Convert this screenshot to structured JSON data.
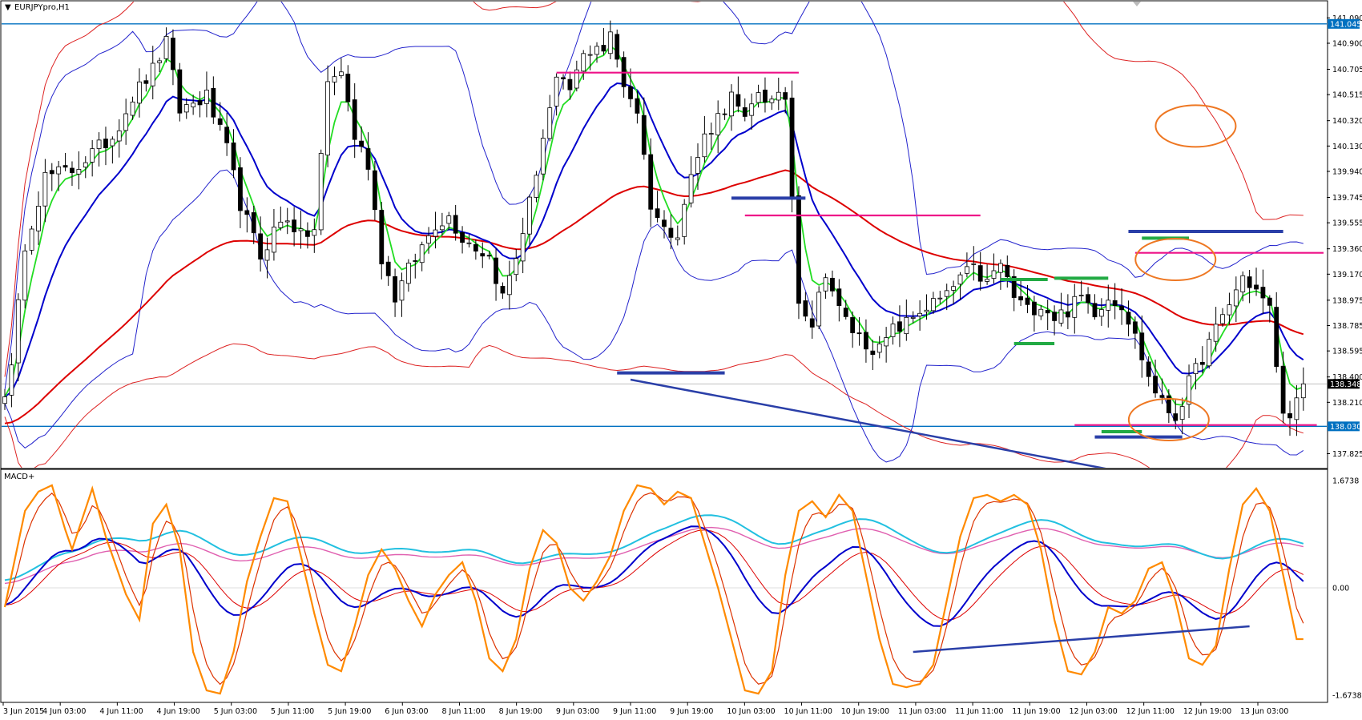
{
  "window": {
    "symbol_title": "EURJPYpro,H1",
    "menu_glyph": "▼"
  },
  "colors": {
    "bg": "#ffffff",
    "frame": "#000000",
    "candle_up_fill": "#ffffff",
    "candle_down_fill": "#000000",
    "ema_fast": "#22dd22",
    "ema_mid": "#0000cc",
    "ema_slow": "#dd0000",
    "bb_inner": "#2222cc",
    "bb_outer": "#dd2222",
    "support_line": "#0070c0",
    "magenta": "#ee1188",
    "green_marker": "#22aa44",
    "blue_marker": "#2a3fa8",
    "orange": "#ee7722",
    "macd_orange": "#ff8a00",
    "macd_cyan": "#22c0e0",
    "macd_pink": "#e060b0"
  },
  "chart_data": [
    {
      "type": "candlestick",
      "instrument": "EURJPY",
      "timeframe": "H1",
      "ylim": [
        137.72,
        141.2
      ],
      "y_ticks": [
        "141.090",
        "140.900",
        "140.705",
        "140.515",
        "140.320",
        "140.130",
        "139.940",
        "139.745",
        "139.555",
        "139.360",
        "139.170",
        "138.975",
        "138.785",
        "138.595",
        "138.400",
        "138.210",
        "137.825"
      ],
      "price_tags": [
        {
          "label": "141.045",
          "value": 141.045,
          "kind": "level"
        },
        {
          "label": "138.348",
          "value": 138.348,
          "kind": "current"
        },
        {
          "label": "138.030",
          "value": 138.03,
          "kind": "level"
        }
      ],
      "horizontal_levels": [
        141.045,
        138.03
      ],
      "x_labels": [
        "3 Jun 2015",
        "4 Jun 03:00",
        "4 Jun 11:00",
        "4 Jun 19:00",
        "5 Jun 03:00",
        "5 Jun 11:00",
        "5 Jun 19:00",
        "6 Jun 03:00",
        "8 Jun 11:00",
        "8 Jun 19:00",
        "9 Jun 03:00",
        "9 Jun 11:00",
        "9 Jun 19:00",
        "10 Jun 03:00",
        "10 Jun 11:00",
        "10 Jun 19:00",
        "11 Jun 03:00",
        "11 Jun 11:00",
        "11 Jun 19:00",
        "12 Jun 03:00",
        "12 Jun 11:00",
        "12 Jun 19:00",
        "13 Jun 03:00"
      ],
      "close_path": [
        [
          0,
          138.3
        ],
        [
          1,
          138.45
        ],
        [
          3,
          139.4
        ],
        [
          6,
          139.9
        ],
        [
          10,
          139.95
        ],
        [
          16,
          140.2
        ],
        [
          19,
          140.5
        ],
        [
          22,
          140.7
        ],
        [
          24,
          140.9
        ],
        [
          26,
          140.4
        ],
        [
          30,
          140.5
        ],
        [
          33,
          140.1
        ],
        [
          35,
          139.7
        ],
        [
          38,
          139.3
        ],
        [
          40,
          139.5
        ],
        [
          42,
          139.6
        ],
        [
          44,
          139.45
        ],
        [
          46,
          139.5
        ],
        [
          48,
          140.6
        ],
        [
          50,
          140.7
        ],
        [
          52,
          140.2
        ],
        [
          54,
          140.0
        ],
        [
          56,
          139.3
        ],
        [
          58,
          139.0
        ],
        [
          60,
          139.2
        ],
        [
          64,
          139.55
        ],
        [
          66,
          139.6
        ],
        [
          68,
          139.45
        ],
        [
          72,
          139.3
        ],
        [
          74,
          139.0
        ],
        [
          76,
          139.3
        ],
        [
          78,
          139.7
        ],
        [
          80,
          140.2
        ],
        [
          82,
          140.6
        ],
        [
          84,
          140.55
        ],
        [
          86,
          140.8
        ],
        [
          88,
          140.9
        ],
        [
          89,
          140.85
        ],
        [
          90,
          140.95
        ],
        [
          92,
          140.6
        ],
        [
          94,
          140.4
        ],
        [
          96,
          139.7
        ],
        [
          98,
          139.5
        ],
        [
          100,
          139.5
        ],
        [
          102,
          139.9
        ],
        [
          104,
          140.2
        ],
        [
          106,
          140.35
        ],
        [
          108,
          140.5
        ],
        [
          110,
          140.3
        ],
        [
          112,
          140.55
        ],
        [
          114,
          140.45
        ],
        [
          116,
          140.5
        ],
        [
          118,
          139.0
        ],
        [
          120,
          138.8
        ],
        [
          122,
          139.2
        ],
        [
          124,
          138.9
        ],
        [
          126,
          138.75
        ],
        [
          128,
          138.65
        ],
        [
          130,
          138.6
        ],
        [
          132,
          138.75
        ],
        [
          134,
          138.8
        ],
        [
          136,
          138.9
        ],
        [
          138,
          138.95
        ],
        [
          140,
          139.0
        ],
        [
          142,
          139.15
        ],
        [
          144,
          139.2
        ],
        [
          146,
          139.1
        ],
        [
          148,
          139.25
        ],
        [
          150,
          139.0
        ],
        [
          152,
          138.9
        ],
        [
          154,
          138.95
        ],
        [
          156,
          138.85
        ],
        [
          158,
          138.9
        ],
        [
          160,
          139.0
        ],
        [
          162,
          138.9
        ],
        [
          164,
          139.0
        ],
        [
          166,
          138.95
        ],
        [
          168,
          138.7
        ],
        [
          170,
          138.4
        ],
        [
          172,
          138.2
        ],
        [
          174,
          138.1
        ],
        [
          176,
          138.35
        ],
        [
          178,
          138.55
        ],
        [
          180,
          138.75
        ],
        [
          182,
          138.95
        ],
        [
          184,
          139.15
        ],
        [
          186,
          139.05
        ],
        [
          188,
          138.9
        ],
        [
          190,
          138.1
        ],
        [
          192,
          138.2
        ],
        [
          193,
          138.348
        ]
      ],
      "series": [
        {
          "name": "",
          "kind": "ema_fast"
        },
        {
          "name": "",
          "kind": "ema_mid"
        },
        {
          "name": "",
          "kind": "ema_slow"
        },
        {
          "name": "",
          "kind": "bollinger_inner"
        },
        {
          "name": "",
          "kind": "bollinger_outer"
        }
      ],
      "annotations": {
        "magenta_lines": [
          [
            {
              "i": 82,
              "v": 140.68
            },
            {
              "i": 118,
              "v": 140.68
            }
          ],
          [
            {
              "i": 110,
              "v": 139.61
            },
            {
              "i": 145,
              "v": 139.61
            }
          ],
          [
            {
              "i": 168,
              "v": 139.33
            },
            {
              "i": 196,
              "v": 139.33
            }
          ],
          [
            {
              "i": 159,
              "v": 138.04
            },
            {
              "i": 195,
              "v": 138.04
            }
          ]
        ],
        "blue_bars": [
          [
            {
              "i": 91,
              "v": 138.43
            },
            {
              "i": 107,
              "v": 138.43
            }
          ],
          [
            {
              "i": 108,
              "v": 139.74
            },
            {
              "i": 119,
              "v": 139.74
            }
          ],
          [
            {
              "i": 167,
              "v": 139.49
            },
            {
              "i": 190,
              "v": 139.49
            }
          ],
          [
            {
              "i": 162,
              "v": 137.95
            },
            {
              "i": 175,
              "v": 137.95
            }
          ]
        ],
        "green_bars": [
          [
            {
              "i": 148,
              "v": 139.13
            },
            {
              "i": 155,
              "v": 139.13
            }
          ],
          [
            {
              "i": 156,
              "v": 139.14
            },
            {
              "i": 164,
              "v": 139.14
            }
          ],
          [
            {
              "i": 150,
              "v": 138.65
            },
            {
              "i": 156,
              "v": 138.65
            }
          ],
          [
            {
              "i": 163,
              "v": 137.99
            },
            {
              "i": 169,
              "v": 137.99
            }
          ],
          [
            {
              "i": 169,
              "v": 139.44
            },
            {
              "i": 176,
              "v": 139.44
            }
          ]
        ],
        "trend_lines": [
          [
            {
              "i": 93,
              "v": 138.38
            },
            {
              "i": 165,
              "v": 137.7
            }
          ]
        ],
        "ellipses": [
          {
            "i": 177,
            "v": 140.28
          },
          {
            "i": 174,
            "v": 139.28
          },
          {
            "i": 173,
            "v": 138.08
          }
        ]
      }
    },
    {
      "type": "line",
      "indicator_title": "MACD+",
      "ylim": [
        -1.6738,
        1.6738
      ],
      "y_ticks": [
        "1.6738",
        "0.00",
        "-1.6738"
      ],
      "series": [
        {
          "name": "",
          "kind": "macd_fast",
          "points": [
            [
              0,
              -0.3
            ],
            [
              3,
              1.2
            ],
            [
              5,
              1.5
            ],
            [
              7,
              1.6
            ],
            [
              9,
              0.9
            ],
            [
              10,
              0.6
            ],
            [
              13,
              1.55
            ],
            [
              15,
              0.8
            ],
            [
              18,
              -0.1
            ],
            [
              20,
              -0.5
            ],
            [
              22,
              1.0
            ],
            [
              24,
              1.3
            ],
            [
              26,
              0.6
            ],
            [
              28,
              -1.0
            ],
            [
              30,
              -1.6
            ],
            [
              32,
              -1.65
            ],
            [
              34,
              -1.0
            ],
            [
              36,
              0.1
            ],
            [
              38,
              0.8
            ],
            [
              40,
              1.4
            ],
            [
              42,
              1.35
            ],
            [
              44,
              0.5
            ],
            [
              46,
              -0.4
            ],
            [
              48,
              -1.2
            ],
            [
              50,
              -1.3
            ],
            [
              52,
              -0.6
            ],
            [
              54,
              0.2
            ],
            [
              56,
              0.6
            ],
            [
              58,
              0.3
            ],
            [
              60,
              -0.2
            ],
            [
              62,
              -0.6
            ],
            [
              64,
              -0.1
            ],
            [
              66,
              0.2
            ],
            [
              68,
              0.4
            ],
            [
              70,
              -0.2
            ],
            [
              72,
              -1.1
            ],
            [
              74,
              -1.3
            ],
            [
              76,
              -0.8
            ],
            [
              78,
              0.3
            ],
            [
              80,
              0.9
            ],
            [
              82,
              0.7
            ],
            [
              84,
              0.0
            ],
            [
              86,
              -0.2
            ],
            [
              88,
              0.1
            ],
            [
              90,
              0.5
            ],
            [
              92,
              1.2
            ],
            [
              94,
              1.6
            ],
            [
              96,
              1.55
            ],
            [
              98,
              1.3
            ],
            [
              100,
              1.5
            ],
            [
              102,
              1.4
            ],
            [
              104,
              0.7
            ],
            [
              106,
              0.0
            ],
            [
              108,
              -0.8
            ],
            [
              110,
              -1.6
            ],
            [
              112,
              -1.65
            ],
            [
              114,
              -1.3
            ],
            [
              116,
              0.2
            ],
            [
              118,
              1.2
            ],
            [
              120,
              1.35
            ],
            [
              122,
              1.1
            ],
            [
              124,
              1.45
            ],
            [
              126,
              1.2
            ],
            [
              128,
              0.2
            ],
            [
              130,
              -0.8
            ],
            [
              132,
              -1.5
            ],
            [
              134,
              -1.55
            ],
            [
              136,
              -1.5
            ],
            [
              138,
              -1.2
            ],
            [
              140,
              -0.2
            ],
            [
              142,
              0.8
            ],
            [
              144,
              1.4
            ],
            [
              146,
              1.45
            ],
            [
              148,
              1.35
            ],
            [
              150,
              1.45
            ],
            [
              152,
              1.3
            ],
            [
              154,
              0.6
            ],
            [
              156,
              -0.5
            ],
            [
              158,
              -1.3
            ],
            [
              160,
              -1.35
            ],
            [
              162,
              -1.0
            ],
            [
              164,
              -0.3
            ],
            [
              166,
              -0.4
            ],
            [
              168,
              -0.2
            ],
            [
              170,
              0.3
            ],
            [
              172,
              0.4
            ],
            [
              174,
              -0.2
            ],
            [
              176,
              -1.1
            ],
            [
              178,
              -1.2
            ],
            [
              180,
              -0.9
            ],
            [
              182,
              0.3
            ],
            [
              184,
              1.3
            ],
            [
              186,
              1.55
            ],
            [
              188,
              1.2
            ],
            [
              190,
              0.2
            ],
            [
              192,
              -0.8
            ]
          ]
        },
        {
          "name": "",
          "kind": "macd_slow"
        },
        {
          "name": "",
          "kind": "signal_cyan"
        },
        {
          "name": "",
          "kind": "signal_pink"
        }
      ],
      "trend_lines": [
        [
          {
            "i": 135,
            "v": -1.0
          },
          {
            "i": 185,
            "v": -0.6
          }
        ]
      ]
    }
  ]
}
